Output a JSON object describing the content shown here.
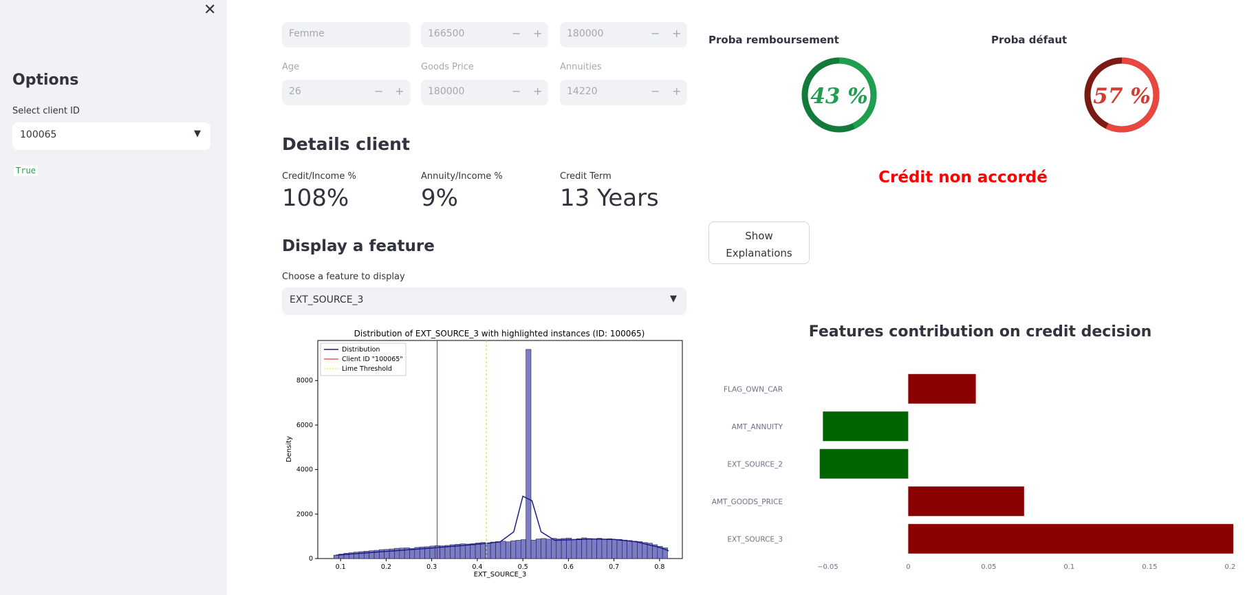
{
  "sidebar": {
    "title": "Options",
    "select_label": "Select client ID",
    "client_id": "100065",
    "flag": "True"
  },
  "inputs": {
    "gender": "Femme",
    "income": "166500",
    "credit": "180000",
    "age_label": "Age",
    "age": "26",
    "goods_label": "Goods Price",
    "goods": "180000",
    "annuities_label": "Annuities",
    "annuities": "14220",
    "minus": "−",
    "plus": "+"
  },
  "details": {
    "title": "Details client",
    "metrics": [
      {
        "label": "Credit/Income %",
        "value": "108%"
      },
      {
        "label": "Annuity/Income %",
        "value": "9%"
      },
      {
        "label": "Credit Term",
        "value": "13 Years"
      }
    ]
  },
  "feature": {
    "title": "Display a feature",
    "select_label": "Choose a feature to display",
    "selected": "EXT_SOURCE_3"
  },
  "gauges": {
    "repay": {
      "title": "Proba remboursement",
      "value_text": "43 %",
      "value": 0.43,
      "color": "#1e9e4e",
      "dark": "#137a3b"
    },
    "default": {
      "title": "Proba défaut",
      "value_text": "57 %",
      "value": 0.57,
      "color": "#e8473f",
      "dark": "#7a1a13"
    }
  },
  "verdict": "Crédit non accordé",
  "show_button": {
    "line1": "Show",
    "line2": "Explanations"
  },
  "contrib": {
    "title": "Features contribution on credit decision"
  },
  "chart_data": [
    {
      "type": "bar",
      "title": "Distribution of EXT_SOURCE_3 with highlighted instances (ID: 100065)",
      "xlabel": "EXT_SOURCE_3",
      "ylabel": "Density",
      "xlim": [
        0.05,
        0.85
      ],
      "ylim": [
        0,
        9800
      ],
      "xticks": [
        0.1,
        0.2,
        0.3,
        0.4,
        0.5,
        0.6,
        0.7,
        0.8
      ],
      "xtick_labels": [
        "0.1",
        "0.2",
        "0.3",
        "0.4",
        "0.5",
        "0.6",
        "0.7",
        "0.8"
      ],
      "yticks": [
        0,
        2000,
        4000,
        6000,
        8000
      ],
      "ytick_labels": [
        "0",
        "2000",
        "4000",
        "6000",
        "8000"
      ],
      "legend": [
        "Distribution",
        "Client ID \"100065\"",
        "Lime Threshold"
      ],
      "legend_position": "top-left",
      "bin_start": 0.085,
      "bin_width": 0.0111,
      "values": [
        150,
        200,
        240,
        260,
        290,
        310,
        330,
        350,
        370,
        400,
        410,
        430,
        460,
        470,
        480,
        450,
        500,
        520,
        530,
        560,
        580,
        570,
        590,
        620,
        640,
        660,
        650,
        670,
        700,
        720,
        680,
        740,
        760,
        780,
        750,
        800,
        820,
        850,
        9400,
        830,
        880,
        900,
        870,
        910,
        880,
        900,
        920,
        860,
        890,
        930,
        900,
        880,
        910,
        870,
        890,
        850,
        860,
        830,
        810,
        780,
        760,
        720,
        690,
        620,
        550,
        480
      ],
      "kde": [
        [
          0.09,
          150
        ],
        [
          0.2,
          320
        ],
        [
          0.3,
          470
        ],
        [
          0.4,
          640
        ],
        [
          0.45,
          750
        ],
        [
          0.48,
          1200
        ],
        [
          0.5,
          2800
        ],
        [
          0.52,
          2600
        ],
        [
          0.54,
          1200
        ],
        [
          0.57,
          820
        ],
        [
          0.65,
          880
        ],
        [
          0.7,
          860
        ],
        [
          0.75,
          750
        ],
        [
          0.8,
          500
        ],
        [
          0.82,
          350
        ]
      ],
      "client_line": 0.312,
      "lime_threshold": 0.42
    },
    {
      "type": "bar",
      "orientation": "horizontal",
      "categories": [
        "FLAG_OWN_CAR",
        "AMT_ANNUITY",
        "EXT_SOURCE_2",
        "AMT_GOODS_PRICE",
        "EXT_SOURCE_3"
      ],
      "values": [
        0.042,
        -0.053,
        -0.055,
        0.072,
        0.202
      ],
      "colors": [
        "#8b0000",
        "#006400",
        "#006400",
        "#8b0000",
        "#8b0000"
      ],
      "xlim": [
        -0.06,
        0.205
      ],
      "xticks": [
        -0.05,
        0,
        0.05,
        0.1,
        0.15,
        0.2
      ],
      "xtick_labels": [
        "−0.05",
        "0",
        "0.05",
        "0.1",
        "0.15",
        "0.2"
      ]
    }
  ]
}
